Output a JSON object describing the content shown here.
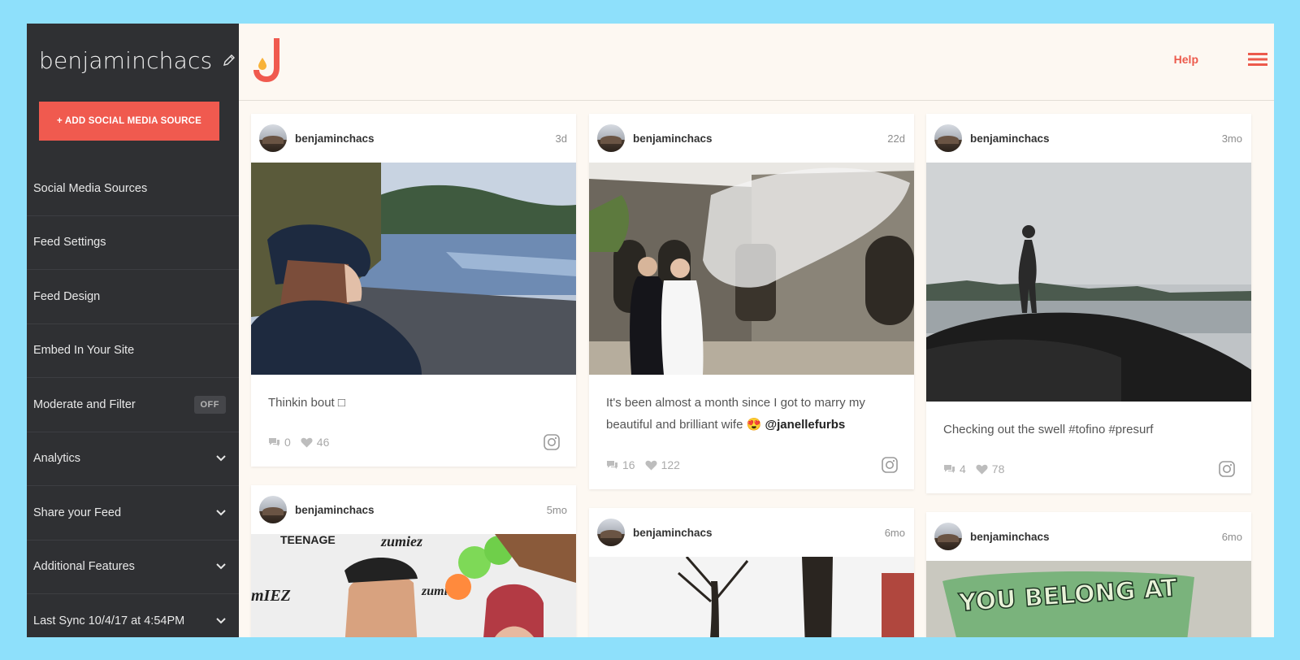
{
  "sidebar": {
    "username": "benjaminchacs",
    "add_button": "+ ADD SOCIAL MEDIA SOURCE",
    "items": [
      {
        "label": "Social Media Sources"
      },
      {
        "label": "Feed Settings"
      },
      {
        "label": "Feed Design"
      },
      {
        "label": "Embed In Your Site"
      },
      {
        "label": "Moderate and Filter",
        "badge": "OFF"
      },
      {
        "label": "Analytics"
      },
      {
        "label": "Share your Feed"
      },
      {
        "label": "Additional Features"
      },
      {
        "label": "Last Sync 10/4/17 at 4:54PM"
      }
    ]
  },
  "header": {
    "help_label": "Help",
    "logo": "juicer-j-logo",
    "menu_icon": "hamburger-icon"
  },
  "colors": {
    "accent": "#f05a4f",
    "sidebar_bg": "#2f3033",
    "page_bg": "#8ee0fb",
    "main_bg": "#fdf8f2"
  },
  "posts": [
    {
      "user": "benjaminchacs",
      "age": "3d",
      "caption": "Thinkin bout □",
      "comments": "0",
      "likes": "46",
      "source_icon": "instagram-icon"
    },
    {
      "user": "benjaminchacs",
      "age": "22d",
      "caption": "It's been almost a month since I got to marry my beautiful and brilliant wife 😍",
      "mention": "@janellefurbs",
      "comments": "16",
      "likes": "122",
      "source_icon": "instagram-icon"
    },
    {
      "user": "benjaminchacs",
      "age": "3mo",
      "caption": "Checking out the swell #tofino #presurf",
      "comments": "4",
      "likes": "78",
      "source_icon": "instagram-icon"
    },
    {
      "user": "benjaminchacs",
      "age": "5mo"
    },
    {
      "user": "benjaminchacs",
      "age": "6mo"
    },
    {
      "user": "benjaminchacs",
      "age": "6mo",
      "photo_text": "YOU BELONG AT"
    }
  ],
  "photo_4_text": {
    "a": "TEENAGE",
    "b": "zumiez",
    "c": "mIEZ",
    "d": "zumiez"
  }
}
